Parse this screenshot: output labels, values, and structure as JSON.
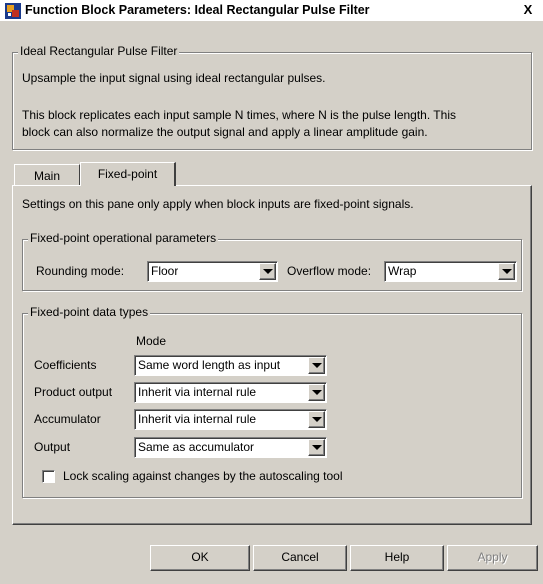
{
  "window": {
    "title": "Function Block Parameters: Ideal Rectangular Pulse Filter",
    "close_label": "X"
  },
  "block": {
    "legend": "Ideal Rectangular Pulse Filter",
    "summary": "Upsample the input signal using ideal rectangular pulses.",
    "description_line1": "This block replicates each input sample N times, where N is the pulse length. This",
    "description_line2": "block can also normalize the output signal and apply a linear amplitude gain."
  },
  "tabs": [
    {
      "label": "Main",
      "active": false
    },
    {
      "label": "Fixed-point",
      "active": true
    }
  ],
  "fixed_point": {
    "note": "Settings on this pane only apply when block inputs are fixed-point signals.",
    "operational": {
      "legend": "Fixed-point operational parameters",
      "rounding_label": "Rounding mode:",
      "rounding_value": "Floor",
      "overflow_label": "Overflow mode:",
      "overflow_value": "Wrap"
    },
    "data_types": {
      "legend": "Fixed-point data types",
      "mode_header": "Mode",
      "rows": [
        {
          "label": "Coefficients",
          "value": "Same word length as input"
        },
        {
          "label": "Product output",
          "value": "Inherit via internal rule"
        },
        {
          "label": "Accumulator",
          "value": "Inherit via internal rule"
        },
        {
          "label": "Output",
          "value": "Same as accumulator"
        }
      ],
      "lock_scaling_label": "Lock scaling against changes by the autoscaling tool",
      "lock_scaling_checked": false
    }
  },
  "buttons": {
    "ok": "OK",
    "cancel": "Cancel",
    "help": "Help",
    "apply": "Apply"
  },
  "colors": {
    "face": "#d4d0c8",
    "shadow": "#808080",
    "highlight": "#ffffff"
  }
}
